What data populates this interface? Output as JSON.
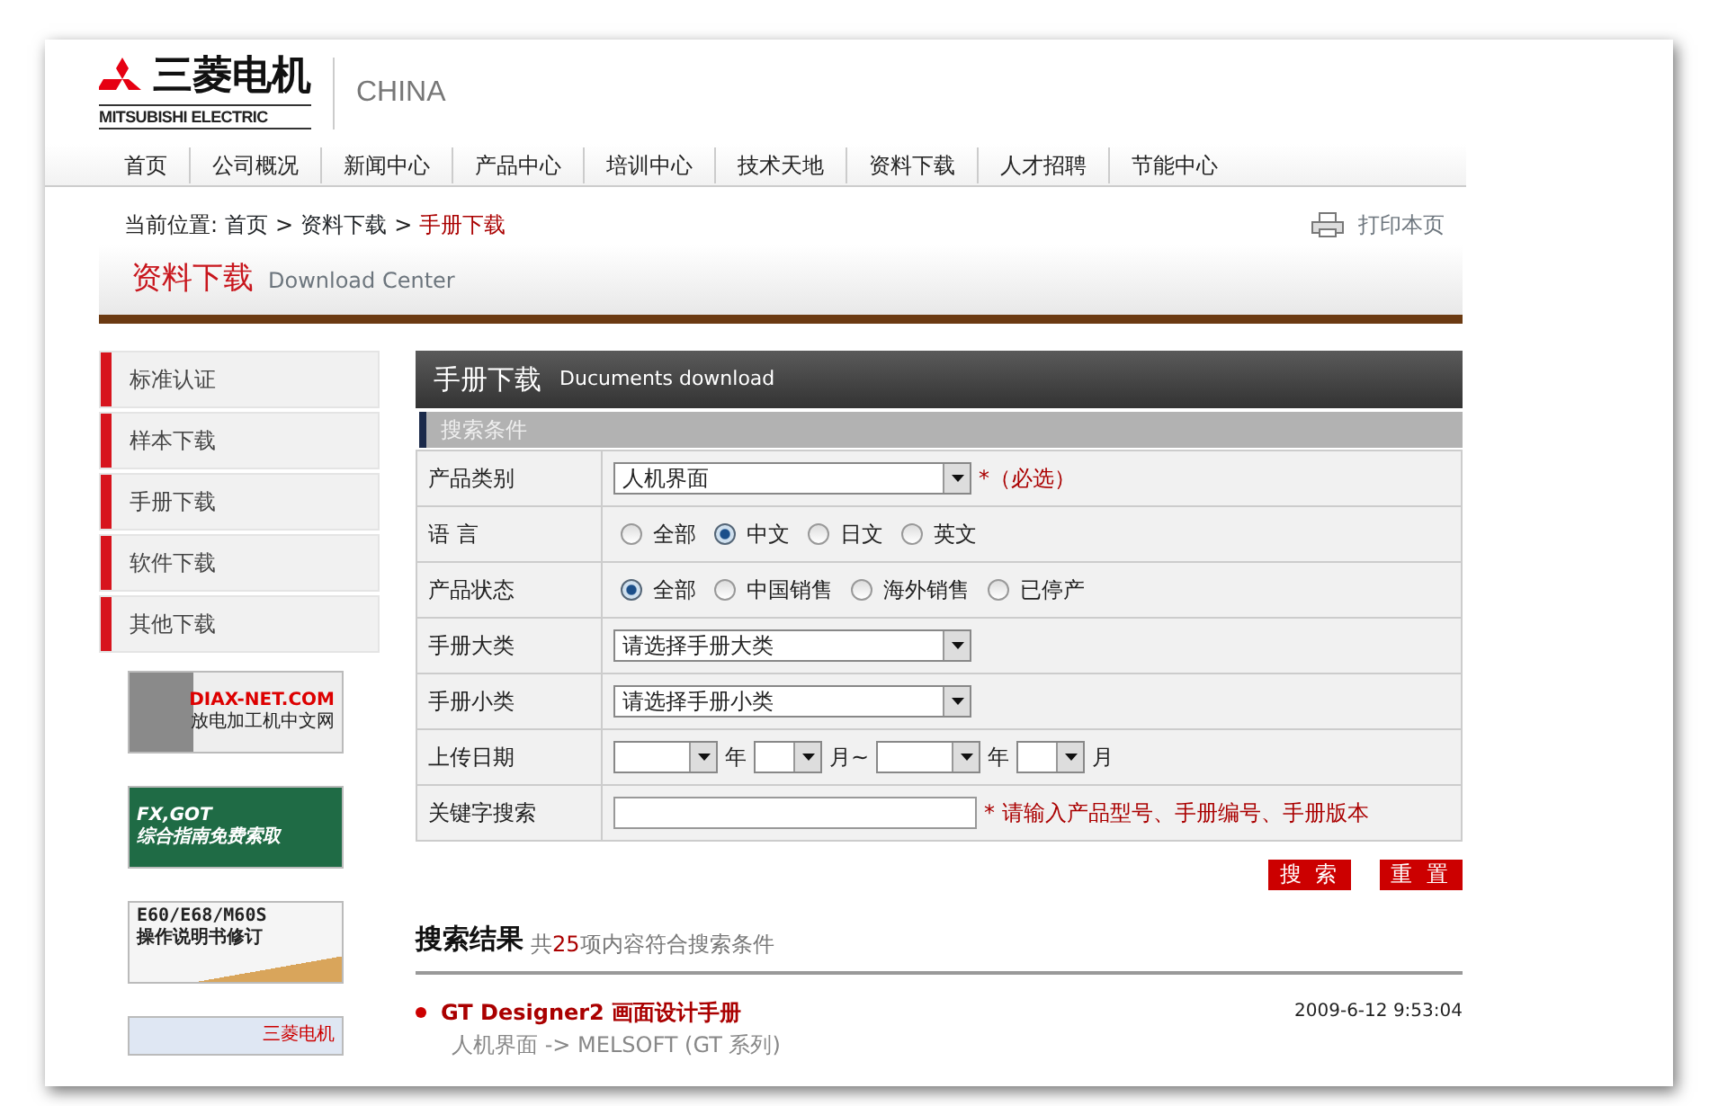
{
  "logo": {
    "brand_cn": "三菱电机",
    "brand_en": "MITSUBISHI ELECTRIC",
    "region": "CHINA"
  },
  "nav": [
    {
      "label": "首页"
    },
    {
      "label": "公司概况"
    },
    {
      "label": "新闻中心"
    },
    {
      "label": "产品中心"
    },
    {
      "label": "培训中心"
    },
    {
      "label": "技术天地"
    },
    {
      "label": "资料下载"
    },
    {
      "label": "人才招聘"
    },
    {
      "label": "节能中心"
    }
  ],
  "breadcrumb": {
    "prefix": "当前位置:",
    "separator": ">",
    "items": [
      {
        "label": "首页",
        "current": false
      },
      {
        "label": "资料下载",
        "current": false
      },
      {
        "label": "手册下载",
        "current": true
      }
    ]
  },
  "print_link": "打印本页",
  "section_banner": {
    "title": "资料下载",
    "subtitle": "Download Center"
  },
  "sidebar": {
    "items": [
      {
        "label": "标准认证"
      },
      {
        "label": "样本下载"
      },
      {
        "label": "手册下载"
      },
      {
        "label": "软件下载"
      },
      {
        "label": "其他下载"
      }
    ],
    "banners": [
      {
        "kind": "machine",
        "lines": [
          "DIAX-NET.COM",
          "放电加工机中文网"
        ]
      },
      {
        "kind": "disc",
        "lines": [
          "FX,GOT",
          "综合指南免费索取"
        ]
      },
      {
        "kind": "book",
        "lines": [
          "E60/E68/M60S",
          "操作说明书修订"
        ]
      },
      {
        "kind": "brand",
        "lines": [
          "三菱电机"
        ]
      }
    ]
  },
  "panel": {
    "title": "手册下载",
    "subtitle": "Ducuments download",
    "search_header": "搜索条件",
    "rows": [
      {
        "label": "产品类别",
        "kind": "select",
        "value": "人机界面",
        "note": "*（必选）"
      },
      {
        "label": "语 言",
        "kind": "radio",
        "options": [
          {
            "label": "全部",
            "selected": false
          },
          {
            "label": "中文",
            "selected": true
          },
          {
            "label": "日文",
            "selected": false
          },
          {
            "label": "英文",
            "selected": false
          }
        ]
      },
      {
        "label": "产品状态",
        "kind": "radio",
        "options": [
          {
            "label": "全部",
            "selected": true
          },
          {
            "label": "中国销售",
            "selected": false
          },
          {
            "label": "海外销售",
            "selected": false
          },
          {
            "label": "已停产",
            "selected": false
          }
        ]
      },
      {
        "label": "手册大类",
        "kind": "select",
        "value": "请选择手册大类"
      },
      {
        "label": "手册小类",
        "kind": "select",
        "value": "请选择手册小类"
      },
      {
        "label": "上传日期",
        "kind": "date",
        "units": [
          "年",
          "月~",
          "年",
          "月"
        ]
      },
      {
        "label": "关键字搜索",
        "kind": "text",
        "note": "* 请输入产品型号、手册编号、手册版本"
      }
    ],
    "buttons": [
      "搜 索",
      "重 置"
    ]
  },
  "results": {
    "title": "搜索结果",
    "summary_before": "共",
    "count": "25",
    "summary_after": "项内容符合搜索条件",
    "items": [
      {
        "title": "GT Designer2 画面设计手册",
        "date": "2009-6-12 9:53:04",
        "path": "人机界面 -> MELSOFT (GT 系列)"
      }
    ]
  }
}
